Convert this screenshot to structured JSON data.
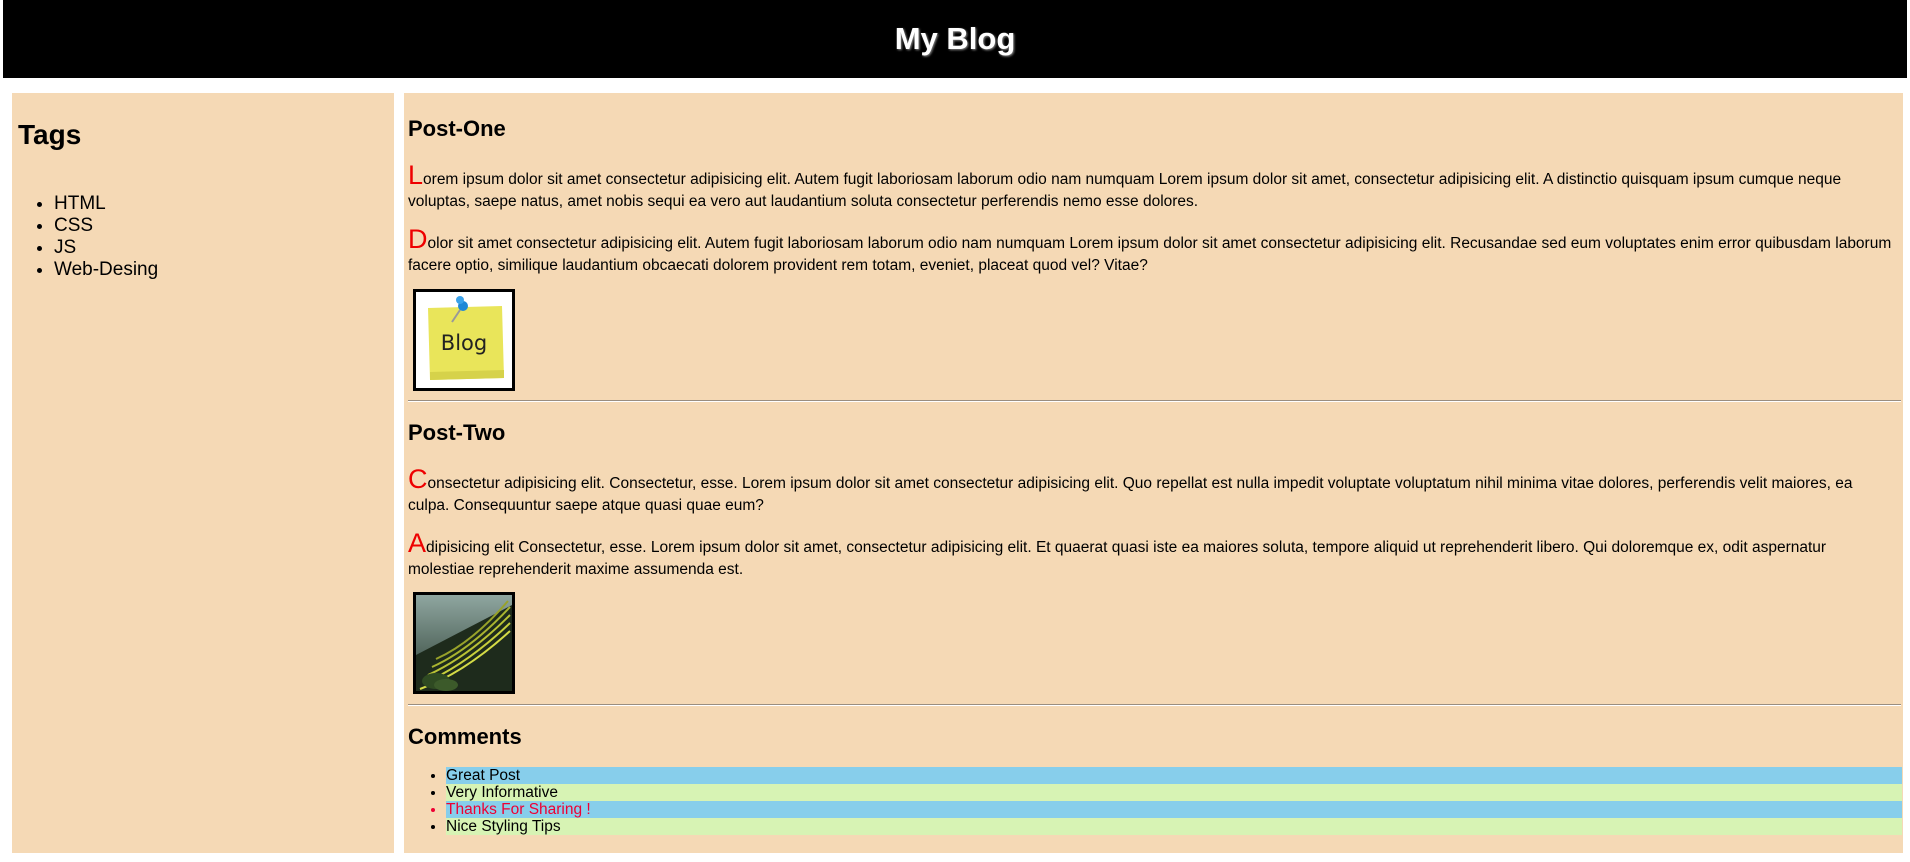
{
  "header": {
    "title": "My Blog"
  },
  "sidebar": {
    "heading": "Tags",
    "tags": [
      "HTML",
      "CSS",
      "JS",
      "Web-Desing"
    ]
  },
  "posts": [
    {
      "title": "Post-One",
      "paragraphs": [
        {
          "initial": "L",
          "text": "orem ipsum dolor sit amet consectetur adipisicing elit. Autem fugit laboriosam laborum odio nam numquam Lorem ipsum dolor sit amet, consectetur adipisicing elit. A distinctio quisquam ipsum cumque neque voluptas, saepe natus, amet nobis sequi ea vero aut laudantium soluta consectetur perferendis nemo esse dolores."
        },
        {
          "initial": "D",
          "text": "olor sit amet consectetur adipisicing elit. Autem fugit laboriosam laborum odio nam numquam Lorem ipsum dolor sit amet consectetur adipisicing elit. Recusandae sed eum voluptates enim error quibusdam laborum facere optio, similique laudantium obcaecati dolorem provident rem totam, eveniet, placeat quod vel? Vitae?"
        }
      ],
      "image_label": "Blog"
    },
    {
      "title": "Post-Two",
      "paragraphs": [
        {
          "initial": "C",
          "text": "onsectetur adipisicing elit. Consectetur, esse. Lorem ipsum dolor sit amet consectetur adipisicing elit. Quo repellat est nulla impedit voluptate voluptatum nihil minima vitae dolores, perferendis velit maiores, ea culpa. Consequuntur saepe atque quasi quae eum?"
        },
        {
          "initial": "A",
          "text": "dipisicing elit Consectetur, esse. Lorem ipsum dolor sit amet, consectetur adipisicing elit. Et quaerat quasi iste ea maiores soluta, tempore aliquid ut reprehenderit libero. Qui doloremque ex, odit aspernatur molestiae reprehenderit maxime assumenda est."
        }
      ]
    }
  ],
  "comments": {
    "heading": "Comments",
    "items": [
      "Great Post",
      "Very Informative",
      "Thanks For Sharing !",
      "Nice Styling Tips"
    ]
  },
  "colors": {
    "panel": "#f5d9b5",
    "drop_cap": "#ee0000",
    "comment_blue": "#87ceeb",
    "comment_green": "#d7f3b4",
    "comment_red_text": "#ee0033"
  }
}
